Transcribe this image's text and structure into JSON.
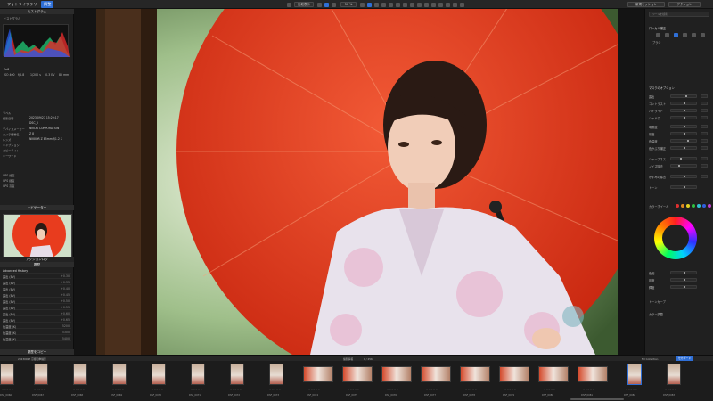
{
  "topbar": {
    "tabs": [
      "フォトライブラリ",
      "調整"
    ],
    "center_chips": [
      "比較表示",
      "50 %"
    ],
    "right_chips": [
      "新規セッション",
      "アクション"
    ]
  },
  "left_panel": {
    "histogram_title": "ヒストグラム",
    "histogram_sub": "ヒストグラム",
    "exif_vals": [
      "ISO 400",
      "f/2.8",
      "1/200 s",
      "-0.3 EV",
      "85 mm"
    ],
    "meta": [
      {
        "k": "ラベル",
        "v": ""
      },
      {
        "k": "撮影日時",
        "v": "2023/09/27 15:29:17"
      },
      {
        "k": "",
        "v": "DSC_0"
      },
      {
        "k": "デバイスメーカー",
        "v": "NIKON CORPORATION"
      },
      {
        "k": "カメラ機種名",
        "v": "Z 8"
      },
      {
        "k": "レンズ",
        "v": "NIKKOR Z 85mm f/1.2 S"
      },
      {
        "k": "キャプション",
        "v": ""
      },
      {
        "k": "コピーライト",
        "v": ""
      },
      {
        "k": "キーワード",
        "v": ""
      },
      {
        "k": "GPS 緯度",
        "v": ""
      },
      {
        "k": "GPS 経度",
        "v": ""
      },
      {
        "k": "GPS 高度",
        "v": ""
      }
    ],
    "navigator_title": "ナビゲーター",
    "action_title": "アクションログ",
    "history_title": "履歴",
    "history_rows": [
      {
        "k": "Advanced History",
        "v": ""
      },
      {
        "k": "露出 (EV)",
        "v": "+0.30"
      },
      {
        "k": "露出 (EV)",
        "v": "+0.35"
      },
      {
        "k": "露出 (EV)",
        "v": "+0.40"
      },
      {
        "k": "露出 (EV)",
        "v": "+0.45"
      },
      {
        "k": "露出 (EV)",
        "v": "+0.50"
      },
      {
        "k": "露出 (EV)",
        "v": "+0.55"
      },
      {
        "k": "露出 (EV)",
        "v": "+0.60"
      },
      {
        "k": "露出 (EV)",
        "v": "+0.65"
      },
      {
        "k": "色温度 (K)",
        "v": "5200"
      },
      {
        "k": "色温度 (K)",
        "v": "5300"
      },
      {
        "k": "色温度 (K)",
        "v": "5400"
      }
    ],
    "footer": "履歴をコピー"
  },
  "right_panel": {
    "search_placeholder": "ツールを検索",
    "section": "ローカル補正",
    "brush": "ブラシ",
    "control_title": "マスクのオプション",
    "labels": [
      "露出",
      "コントラスト",
      "ハイライト",
      "シャドウ",
      "明瞭度",
      "彩度",
      "色温度",
      "色かぶり補正",
      "シャープネス",
      "ノイズ除去",
      "かすみの除去",
      "トーン"
    ],
    "color_section": "カラーホイール",
    "after_labels": [
      "色相",
      "彩度",
      "輝度",
      "トーンカーブ",
      "カラー調整"
    ]
  },
  "filmstrip": {
    "header_center": "撮影情報",
    "header_count": "1 / 256",
    "header_right": [
      "Fill Collection",
      "セカボード"
    ],
    "folder_path": "20230927 京都和傘撮影",
    "captions": [
      "DSF_0066",
      "DSF_0067",
      "DSF_0068",
      "DSF_0069",
      "DSF_0070",
      "DSF_0071",
      "DSF_0072",
      "DSF_0073",
      "DSF_0074",
      "DSF_0075",
      "DSF_0076",
      "DSF_0077",
      "DSF_0078",
      "DSF_0079",
      "DSF_0080",
      "DSF_0081",
      "DSF_0082",
      "DSF_0083"
    ]
  },
  "colors": {
    "accent": "#2f6fd6",
    "umbrella": "#e83c1e",
    "panel": "#202020"
  }
}
